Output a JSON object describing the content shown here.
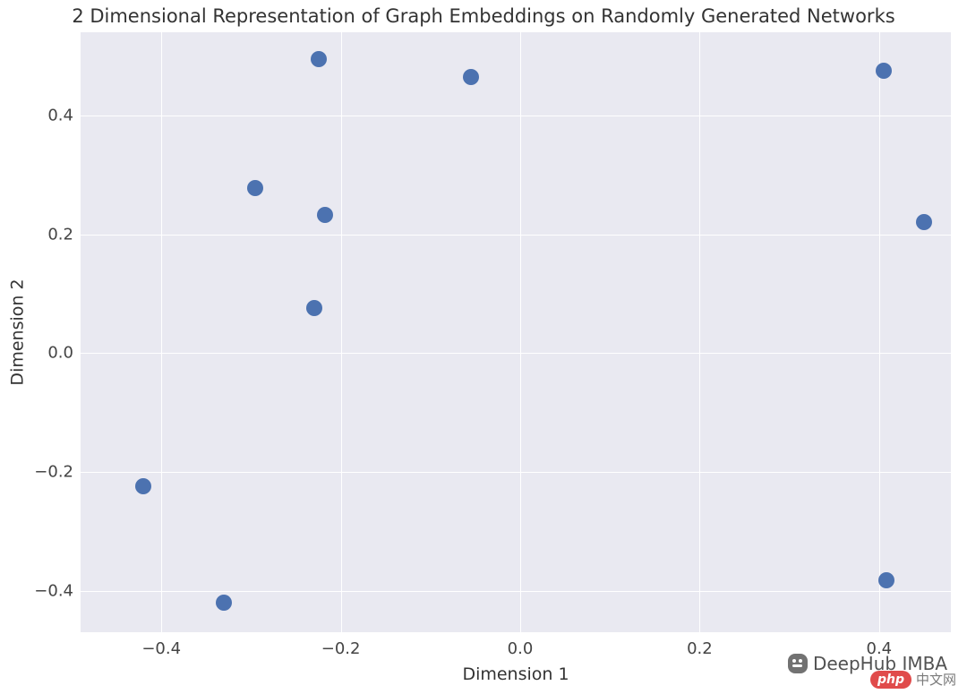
{
  "chart_data": {
    "type": "scatter",
    "title": "2 Dimensional Representation of Graph Embeddings on Randomly Generated Networks",
    "xlabel": "Dimension 1",
    "ylabel": "Dimension 2",
    "xlim": [
      -0.49,
      0.48
    ],
    "ylim": [
      -0.47,
      0.54
    ],
    "xticks": [
      -0.4,
      -0.2,
      0.0,
      0.2,
      0.4
    ],
    "yticks": [
      -0.4,
      -0.2,
      0.0,
      0.2,
      0.4
    ],
    "xtick_labels": [
      "−0.4",
      "−0.2",
      "0.0",
      "0.2",
      "0.4"
    ],
    "ytick_labels": [
      "−0.4",
      "−0.2",
      "0.0",
      "0.2",
      "0.4"
    ],
    "points": [
      {
        "x": -0.225,
        "y": 0.495
      },
      {
        "x": -0.055,
        "y": 0.465
      },
      {
        "x": 0.405,
        "y": 0.475
      },
      {
        "x": -0.295,
        "y": 0.278
      },
      {
        "x": -0.218,
        "y": 0.232
      },
      {
        "x": 0.45,
        "y": 0.22
      },
      {
        "x": -0.23,
        "y": 0.075
      },
      {
        "x": -0.42,
        "y": -0.225
      },
      {
        "x": 0.408,
        "y": -0.382
      },
      {
        "x": -0.33,
        "y": -0.42
      }
    ],
    "marker_color": "#4c72b0",
    "grid": true,
    "background": "#e9e9f1"
  },
  "watermark": {
    "main": "DeepHub IMBA",
    "badge": "php",
    "suffix": "中文网"
  }
}
